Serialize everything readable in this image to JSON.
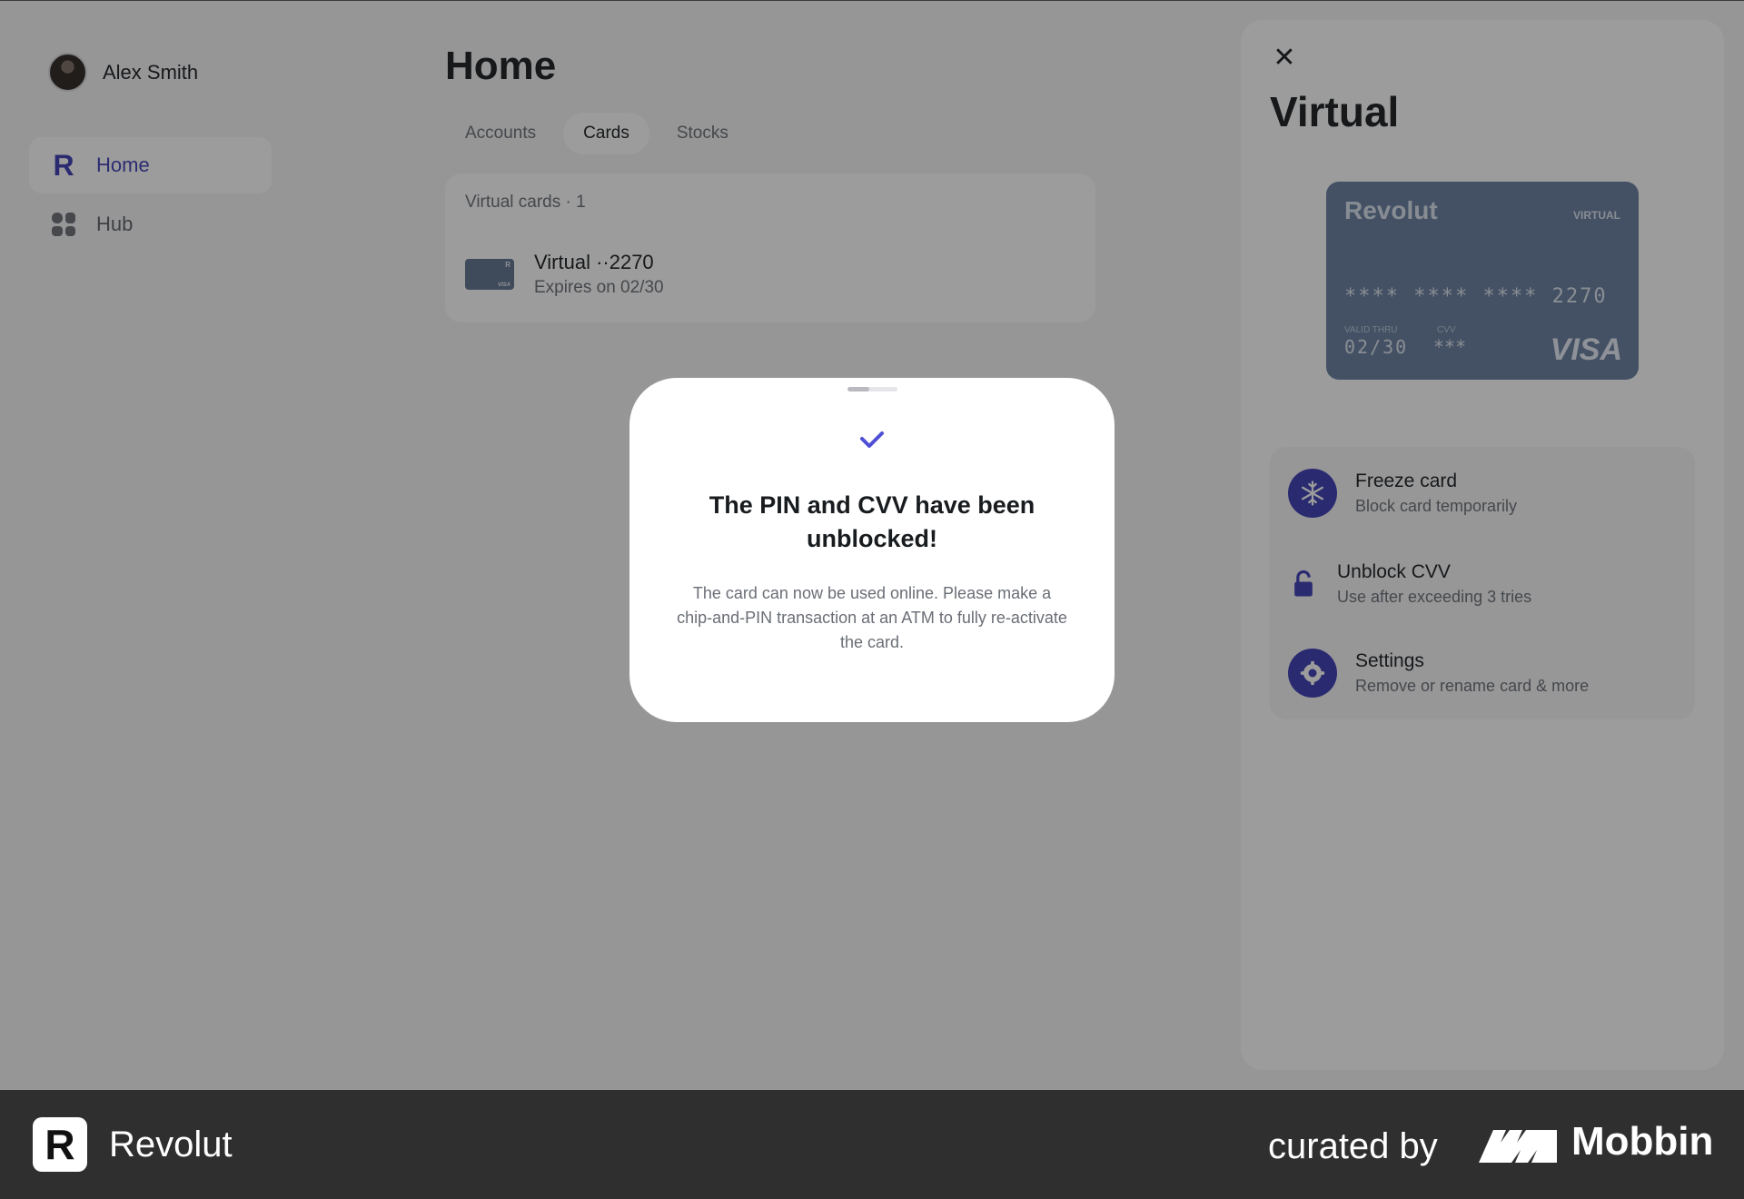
{
  "user": {
    "name": "Alex Smith"
  },
  "sidebar": {
    "items": [
      {
        "label": "Home",
        "icon": "revolut-logo-icon",
        "active": true
      },
      {
        "label": "Hub",
        "icon": "hub-grid-icon",
        "active": false
      }
    ]
  },
  "main": {
    "title": "Home",
    "tabs": [
      {
        "label": "Accounts",
        "active": false
      },
      {
        "label": "Cards",
        "active": true
      },
      {
        "label": "Stocks",
        "active": false
      }
    ],
    "cards_section": {
      "header": "Virtual cards · 1",
      "card": {
        "title": "Virtual ··2270",
        "subtitle": "Expires on 02/30",
        "thumb_brand": "R",
        "thumb_network": "VISA"
      }
    }
  },
  "detail": {
    "title": "Virtual",
    "close_icon": "close-icon",
    "card": {
      "brand": "Revolut",
      "type_label": "VIRTUAL",
      "number": "**** **** **** 2270",
      "valid_label": "VALID THRU",
      "expiry": "02/30",
      "cvv_label": "CVV",
      "cvv": "***",
      "network": "VISA",
      "color": "#687f9f"
    },
    "actions": [
      {
        "title": "Freeze card",
        "subtitle": "Block card temporarily",
        "icon": "snowflake-icon"
      },
      {
        "title": "Unblock CVV",
        "subtitle": "Use after exceeding 3 tries",
        "icon": "unlock-icon"
      },
      {
        "title": "Settings",
        "subtitle": "Remove or rename card & more",
        "icon": "gear-icon"
      }
    ]
  },
  "modal": {
    "icon": "check-icon",
    "title": "The PIN and CVV have been unblocked!",
    "message": "The card can now be used online. Please make a chip-and-PIN transaction at an ATM to fully re-activate the card."
  },
  "footer": {
    "brand": "Revolut",
    "curated_by": "curated by",
    "mobbin": "Mobbin",
    "logo_letter": "R"
  },
  "colors": {
    "accent": "#3b3bb6",
    "check": "#4f4fd6",
    "overlay": "rgba(20,20,20,0.42)",
    "footer": "#2f2f2f"
  }
}
